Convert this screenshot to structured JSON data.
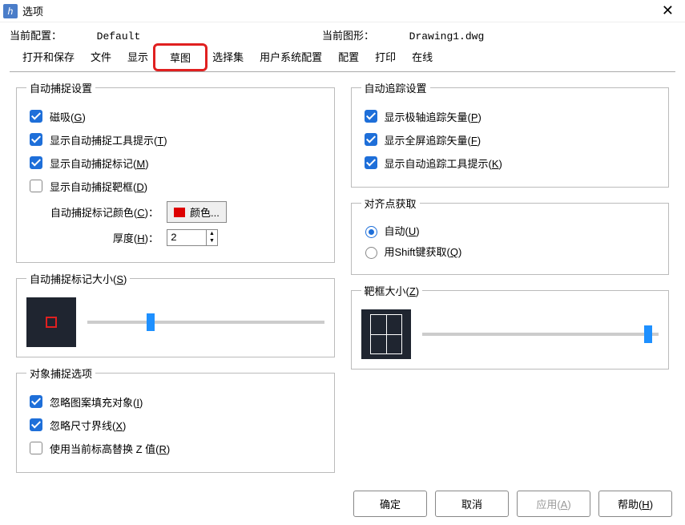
{
  "window": {
    "title": "选项"
  },
  "info": {
    "profile_label": "当前配置：",
    "profile_value": "Default",
    "drawing_label": "当前图形：",
    "drawing_value": "Drawing1.dwg"
  },
  "tabs": {
    "open_save": "打开和保存",
    "file": "文件",
    "display": "显示",
    "sketch": "草图",
    "selection": "选择集",
    "user_sys": "用户系统配置",
    "config": "配置",
    "print": "打印",
    "online": "在线"
  },
  "autosnap": {
    "legend": "自动捕捉设置",
    "magnet": "磁吸(",
    "magnet_k": "G",
    "tooltip": "显示自动捕捉工具提示(",
    "tooltip_k": "T",
    "marker": "显示自动捕捉标记(",
    "marker_k": "M",
    "aperture": "显示自动捕捉靶框(",
    "aperture_k": "D",
    "color_label": "自动捕捉标记颜色(",
    "color_k": "C",
    "color_btn": "颜色...",
    "thickness_label": "厚度(",
    "thickness_k": "H",
    "thickness_val": "2"
  },
  "marker_size": {
    "legend_pre": "自动捕捉标记大小(",
    "legend_k": "S"
  },
  "osnap_opts": {
    "legend": "对象捕捉选项",
    "ignore_hatch": "忽略图案填充对象(",
    "ignore_hatch_k": "I",
    "ignore_dim": "忽略尺寸界线(",
    "ignore_dim_k": "X",
    "replace_z": "使用当前标高替换 Z 值(",
    "replace_z_k": "R"
  },
  "autotrack": {
    "legend": "自动追踪设置",
    "polar": "显示极轴追踪矢量(",
    "polar_k": "P",
    "fullscreen": "显示全屏追踪矢量(",
    "fullscreen_k": "F",
    "tooltip": "显示自动追踪工具提示(",
    "tooltip_k": "K"
  },
  "align": {
    "legend": "对齐点获取",
    "auto": "自动(",
    "auto_k": "U",
    "shift": "用Shift键获取(",
    "shift_k": "Q"
  },
  "aperture_size": {
    "legend_pre": "靶框大小(",
    "legend_k": "Z"
  },
  "footer": {
    "ok": "确定",
    "cancel": "取消",
    "apply_pre": "应用(",
    "apply_k": "A",
    "help_pre": "帮助(",
    "help_k": "H"
  }
}
